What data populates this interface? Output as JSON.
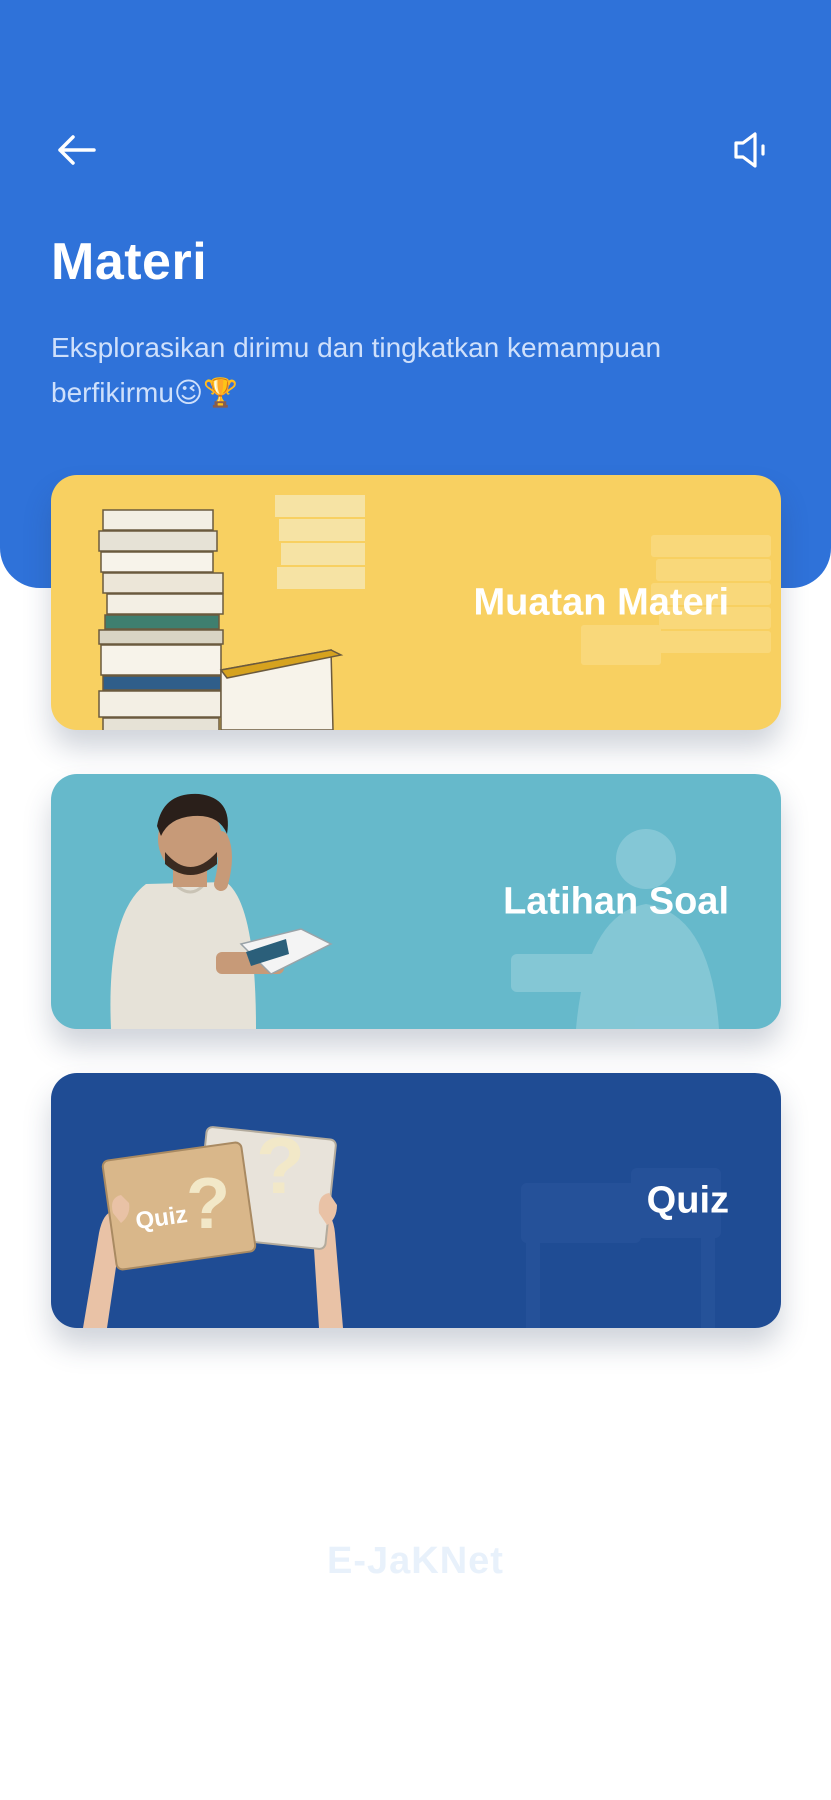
{
  "header": {
    "title": "Materi",
    "subtitle": "Eksplorasikan dirimu dan tingkatkan kemampuan berfikirmu😉🏆",
    "back_icon": "arrow-left-icon",
    "sound_icon": "speaker-icon",
    "bg_color": "#2f72d9"
  },
  "cards": [
    {
      "label": "Muatan Materi",
      "color": "#f8d061",
      "art": "stack-of-books-image"
    },
    {
      "label": "Latihan Soal",
      "color": "#66b9cb",
      "art": "thinking-man-with-notebook-image"
    },
    {
      "label": "Quiz",
      "color": "#1f4c94",
      "art": "hands-holding-quiz-cards-image",
      "art_text": "Quiz"
    }
  ],
  "footer": {
    "watermark": "E-JaKNet"
  }
}
